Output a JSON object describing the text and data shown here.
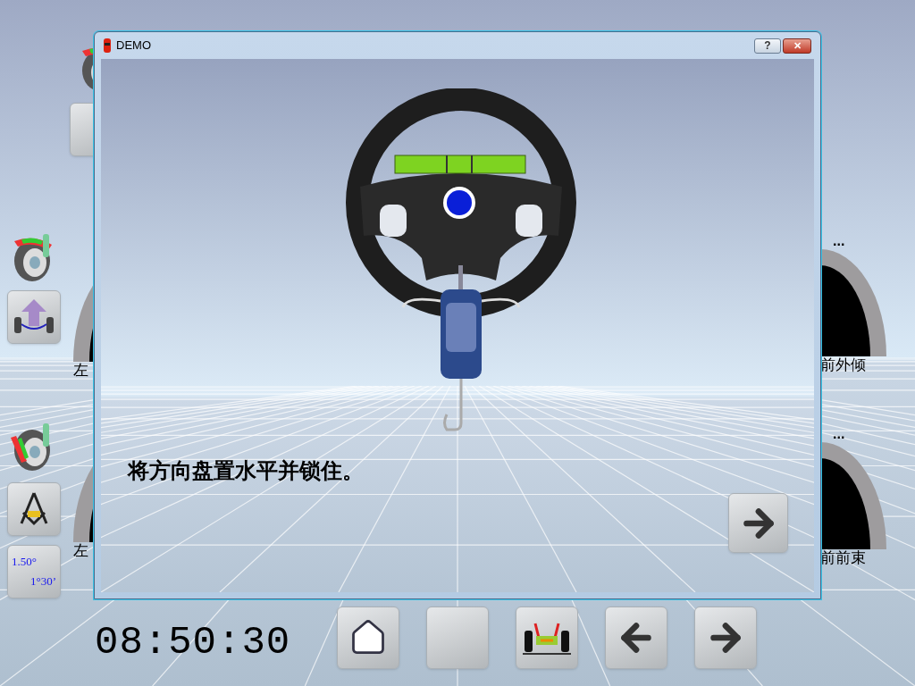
{
  "covered_tools": [
    {
      "kind": "camber_wheel"
    },
    {
      "kind": "camber_wheel_button"
    }
  ],
  "left_tools": [
    {
      "kind": "camber_wheel"
    },
    {
      "kind": "lift"
    },
    {
      "kind": "toe_wheel"
    },
    {
      "kind": "compass"
    },
    {
      "kind": "units",
      "top": "1.50°",
      "bottom": "1°30’"
    }
  ],
  "left_gauges": [
    {
      "label": "左"
    },
    {
      "label": "左"
    }
  ],
  "right_gauges": [
    {
      "reading": "...",
      "label": "前外倾"
    },
    {
      "reading": "...",
      "label": "前前束"
    }
  ],
  "dialog": {
    "title": "DEMO",
    "help": "?",
    "close": "✕",
    "instruction": "将方向盘置水平并锁住。"
  },
  "clock": "08:50:30",
  "toolbar": [
    {
      "kind": "home"
    },
    {
      "kind": "blank"
    },
    {
      "kind": "vehicle"
    },
    {
      "kind": "back"
    },
    {
      "kind": "next"
    }
  ]
}
